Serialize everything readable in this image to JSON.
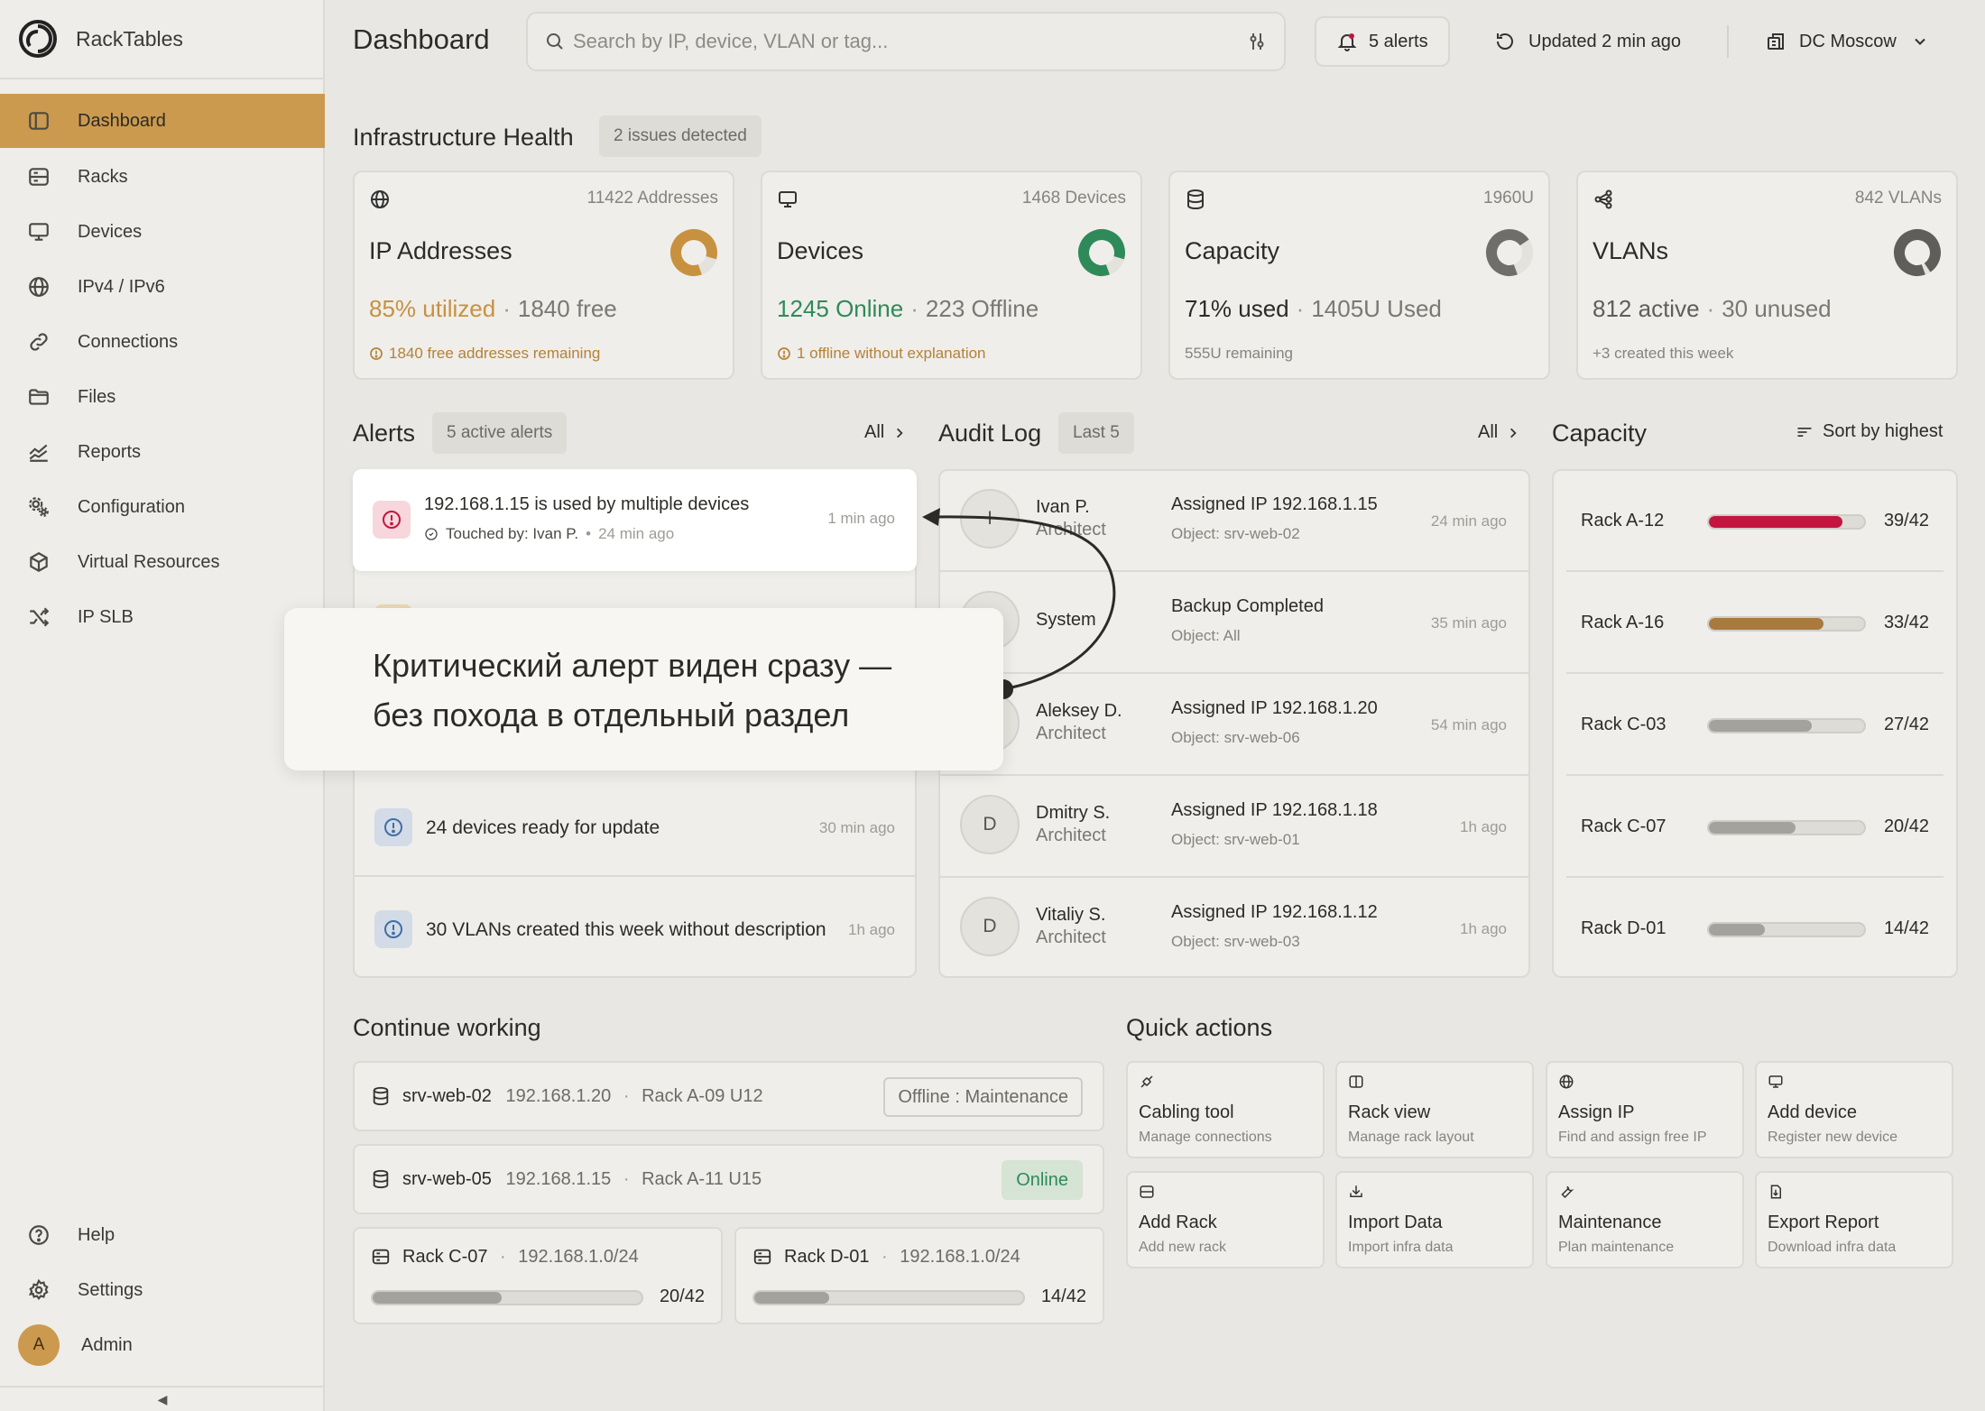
{
  "app": {
    "name": "RackTables"
  },
  "sidebar": {
    "items": [
      {
        "label": "Dashboard",
        "icon": "dashboard-icon"
      },
      {
        "label": "Racks",
        "icon": "rack-icon"
      },
      {
        "label": "Devices",
        "icon": "monitor-icon"
      },
      {
        "label": "IPv4 / IPv6",
        "icon": "globe-icon"
      },
      {
        "label": "Connections",
        "icon": "link-icon"
      },
      {
        "label": "Files",
        "icon": "folder-icon"
      },
      {
        "label": "Reports",
        "icon": "chart-icon"
      },
      {
        "label": "Configuration",
        "icon": "gear-cluster-icon"
      },
      {
        "label": "Virtual Resources",
        "icon": "cube-icon"
      },
      {
        "label": "IP SLB",
        "icon": "shuffle-icon"
      }
    ],
    "bottom": {
      "help": "Help",
      "settings": "Settings",
      "user": "Admin",
      "avatar_initial": "A"
    },
    "collapse_glyph": "◀"
  },
  "header": {
    "title": "Dashboard",
    "search_placeholder": "Search by IP, device, VLAN or tag...",
    "alerts_button": "5 alerts",
    "updated": "Updated 2 min ago",
    "location": "DC Moscow"
  },
  "health": {
    "title": "Infrastructure Health",
    "badge": "2 issues detected",
    "cards": [
      {
        "name": "IP Addresses",
        "count": "11422 Addresses",
        "stat_main": "85% utilized",
        "stat_sep": "·",
        "stat_sub": "1840 free",
        "note": "1840 free addresses remaining",
        "accent": "#c8913f",
        "ring_percent": 85
      },
      {
        "name": "Devices",
        "count": "1468 Devices",
        "stat_main": "1245 Online",
        "stat_sep": "·",
        "stat_sub": "223 Offline",
        "note": "1 offline without explanation",
        "accent": "#2f8a5a",
        "ring_percent": 85
      },
      {
        "name": "Capacity",
        "count": "1960U",
        "stat_main": "71% used",
        "stat_sep": "·",
        "stat_sub": "1405U Used",
        "note": "555U remaining",
        "accent": "#6f6e6a",
        "ring_percent": 71
      },
      {
        "name": "VLANs",
        "count": "842 VLANs",
        "stat_main": "812 active",
        "stat_sep": "·",
        "stat_sub": "30 unused",
        "note": "+3 created this week",
        "accent": "#5f5e5a",
        "ring_percent": 96
      }
    ]
  },
  "alerts": {
    "title": "Alerts",
    "badge": "5 active alerts",
    "all_link": "All",
    "featured": {
      "title": "192.168.1.15 is used by multiple devices",
      "touched": "Touched by: Ivan P.",
      "touched_time": "24 min ago",
      "time": "1 min ago"
    },
    "items": [
      {
        "title": "24 devices ready for update",
        "time": "30 min ago"
      },
      {
        "title": "30 VLANs created this week without description",
        "time": "1h ago"
      }
    ]
  },
  "audit": {
    "title": "Audit Log",
    "badge": "Last 5",
    "all_link": "All",
    "rows": [
      {
        "initial": "I",
        "name": "Ivan P.",
        "role": "Architect",
        "action": "Assigned IP 192.168.1.15",
        "object": "Object: srv-web-02",
        "time": "24 min ago"
      },
      {
        "initial": "",
        "name": "System",
        "role": "",
        "action": "Backup Completed",
        "object": "Object: All",
        "time": "35 min ago"
      },
      {
        "initial": "",
        "name": "Aleksey D.",
        "role": "Architect",
        "action": "Assigned IP 192.168.1.20",
        "object": "Object: srv-web-06",
        "time": "54 min ago"
      },
      {
        "initial": "D",
        "name": "Dmitry S.",
        "role": "Architect",
        "action": "Assigned IP 192.168.1.18",
        "object": "Object: srv-web-01",
        "time": "1h ago"
      },
      {
        "initial": "D",
        "name": "Vitaliy S.",
        "role": "Architect",
        "action": "Assigned IP 192.168.1.12",
        "object": "Object: srv-web-03",
        "time": "1h ago"
      }
    ]
  },
  "capacity": {
    "title": "Capacity",
    "sort": "Sort by highest",
    "racks": [
      {
        "name": "Rack A-12",
        "value": "39/42",
        "fraction": 0.86,
        "color": "#c2163e"
      },
      {
        "name": "Rack A-16",
        "value": "33/42",
        "fraction": 0.74,
        "color": "#a87a3e"
      },
      {
        "name": "Rack C-03",
        "value": "27/42",
        "fraction": 0.66,
        "color": "#a4a29d"
      },
      {
        "name": "Rack C-07",
        "value": "20/42",
        "fraction": 0.56,
        "color": "#a4a29d"
      },
      {
        "name": "Rack D-01",
        "value": "14/42",
        "fraction": 0.36,
        "color": "#a4a29d"
      }
    ]
  },
  "continue": {
    "title": "Continue working",
    "items": [
      {
        "name": "srv-web-02",
        "ip": "192.168.1.20",
        "sep": "·",
        "loc": "Rack A-09 U12",
        "status": "Offline : Maintenance"
      },
      {
        "name": "srv-web-05",
        "ip": "192.168.1.15",
        "sep": "·",
        "loc": "Rack A-11 U15",
        "status": "Online"
      }
    ],
    "racks": [
      {
        "name": "Rack C-07",
        "sep": "·",
        "net": "192.168.1.0/24",
        "value": "20/42",
        "fraction": 0.48
      },
      {
        "name": "Rack D-01",
        "sep": "·",
        "net": "192.168.1.0/24",
        "value": "14/42",
        "fraction": 0.28
      }
    ]
  },
  "quick": {
    "title": "Quick actions",
    "actions": [
      {
        "title": "Cabling tool",
        "sub": "Manage connections"
      },
      {
        "title": "Rack view",
        "sub": "Manage rack layout"
      },
      {
        "title": "Assign IP",
        "sub": "Find and assign free IP"
      },
      {
        "title": "Add device",
        "sub": "Register new device"
      },
      {
        "title": "Add Rack",
        "sub": "Add new rack"
      },
      {
        "title": "Import Data",
        "sub": "Import infra data"
      },
      {
        "title": "Maintenance",
        "sub": "Plan maintenance"
      },
      {
        "title": "Export Report",
        "sub": "Download infra data"
      }
    ]
  },
  "callout": {
    "line1": "Критический алерт виден сразу —",
    "line2": "без похода в отдельный раздел"
  },
  "colors": {
    "accent": "#cc9a4e",
    "critical": "#c2163e",
    "success": "#2f8a5a",
    "info": "#3f6fa8"
  }
}
